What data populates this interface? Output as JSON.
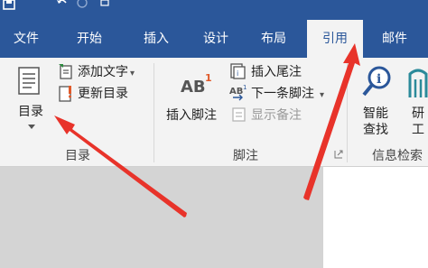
{
  "colors": {
    "brand": "#2b579a",
    "ribbon": "#f3f3f3",
    "arrow": "#e8332a",
    "workspace": "#d4d4d4"
  },
  "quick_access": {
    "save_icon": "save-icon",
    "undo_icon": "undo-icon",
    "redo_icon": "redo-icon",
    "touch_icon": "touch-mode-icon"
  },
  "tabs": [
    "文件",
    "开始",
    "插入",
    "设计",
    "布局",
    "引用",
    "邮件"
  ],
  "active_tab": "引用",
  "ribbon": {
    "toc_group": {
      "label": "目录",
      "toc_button": "目录",
      "toc_dropdown_icon": "chevron-down-icon",
      "add_text": "添加文字",
      "add_text_arrow": "▾",
      "update_toc": "更新目录"
    },
    "footnote_group": {
      "label": "脚注",
      "insert_footnote": "插入脚注",
      "insert_endnote": "插入尾注",
      "next_footnote": "下一条脚注",
      "next_footnote_arrow": "▾",
      "show_notes": "显示备注",
      "dialog_launcher_icon": "dialog-launcher-icon"
    },
    "research_group": {
      "label": "信息检索",
      "smart_lookup_line1": "智能",
      "smart_lookup_line2": "查找",
      "researcher_line1": "研",
      "researcher_line2": "工"
    }
  }
}
